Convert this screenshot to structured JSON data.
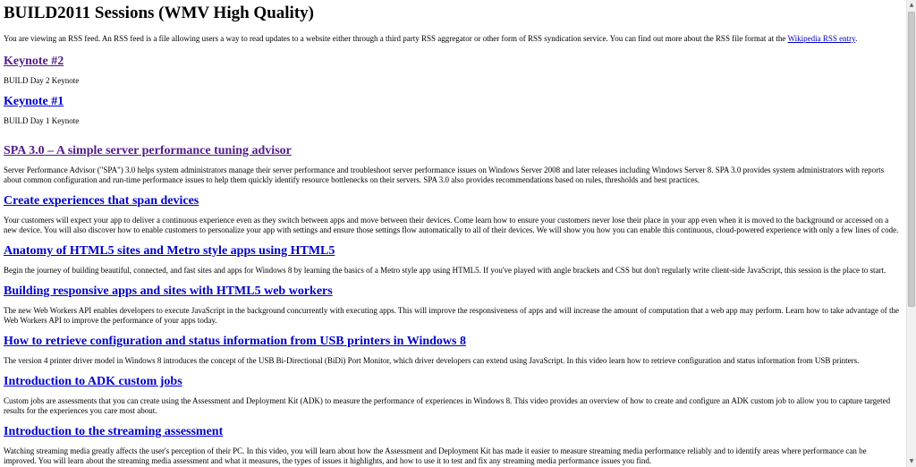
{
  "feed": {
    "title": "BUILD2011 Sessions (WMV High Quality)",
    "intro_text": "You are viewing an RSS feed. An RSS feed is a file allowing users a way to read updates to a website either through a third party RSS aggregator or other form of RSS syndication service. You can find out more about the RSS file format at the ",
    "intro_link": "Wikipedia RSS entry",
    "intro_end": "."
  },
  "items": [
    {
      "title": "Keynote #2",
      "description": "BUILD Day 2 Keynote"
    },
    {
      "title": "Keynote #1",
      "description": "BUILD Day 1 Keynote"
    },
    {
      "title": "SPA 3.0 – A simple server performance tuning advisor",
      "description": "Server Performance Advisor (\"SPA\") 3.0 helps system administrators manage their server performance and troubleshoot server performance issues on Windows Server 2008 and later releases including Windows Server 8. SPA 3.0 provides system administrators with reports about common configuration and run-time performance issues to help them quickly identify resource bottlenecks on their servers. SPA 3.0 also provides recommendations based on rules, thresholds and best practices."
    },
    {
      "title": "Create experiences that span devices",
      "description": "Your customers will expect your app to deliver a continuous experience even as they switch between apps and move between their devices. Come learn how to ensure your customers never lose their place in your app even when it is moved to the background or accessed on a new device. You will also discover how to enable customers to personalize your app with settings and ensure those settings flow automatically to all of their devices. We will show you how you can enable this continuous, cloud-powered experience with only a few lines of code."
    },
    {
      "title": "Anatomy of HTML5 sites and Metro style apps using HTML5",
      "description": "Begin the journey of building beautiful, connected, and fast sites and apps for Windows 8 by learning the basics of a Metro style app using HTML5. If you've played with angle brackets and CSS but don't regularly write client-side JavaScript, this session is the place to start."
    },
    {
      "title": "Building responsive apps and sites with HTML5 web workers",
      "description": "The new Web Workers API enables developers to execute JavaScript in the background concurrently with executing apps. This will improve the responsiveness of apps and will increase the amount of computation that a web app may perform. Learn how to take advantage of the Web Workers API to improve the performance of your apps today."
    },
    {
      "title": "How to retrieve configuration and status information from USB printers in Windows 8",
      "description": "The version 4 printer driver model in Windows 8 introduces the concept of the USB Bi-Directional (BiDi) Port Monitor, which driver developers can extend using JavaScript. In this video learn how to retrieve configuration and status information from USB printers."
    },
    {
      "title": "Introduction to ADK custom jobs",
      "description": "Custom jobs are assessments that you can create using the Assessment and Deployment Kit (ADK) to measure the performance of experiences in Windows 8. This video provides an overview of how to create and configure an ADK custom job to allow you to capture targeted results for the experiences you care most about."
    },
    {
      "title": "Introduction to the streaming assessment",
      "description": "Watching streaming media greatly affects the user's perception of their PC. In this video, you will learn about how the Assessment and Deployment Kit has made it easier to measure streaming media performance reliably and to identify areas where performance can be improved. You will learn about the streaming media assessment and what it measures, the types of issues it highlights, and how to use it to test and fix any streaming media performance issues you find."
    }
  ],
  "scrollbar": {
    "up_arrow_icon": "triangle-up-icon",
    "down_arrow_icon": "triangle-down-icon"
  }
}
